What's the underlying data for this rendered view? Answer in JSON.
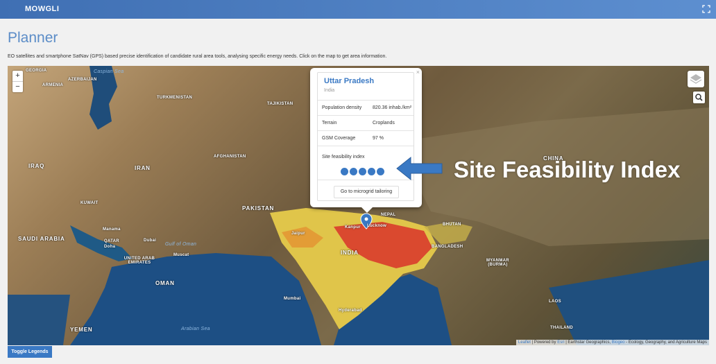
{
  "app": {
    "brand": "MOWGLI"
  },
  "page": {
    "title": "Planner",
    "subtitle": "EO satellites and smartphone SatNav (GPS) based precise identification of candidate rural area tools, analysing specific energy needs. Click on the map to get area information."
  },
  "map": {
    "zoom_in": "+",
    "zoom_out": "−",
    "labels": {
      "caspian": "Caspian Sea",
      "georgia": "GEORGIA",
      "armenia": "ARMENIA",
      "azerbaijan": "AZERBAIJAN",
      "turkmenistan": "TURKMENISTAN",
      "tajikistan": "TAJIKISTAN",
      "iraq": "IRAQ",
      "iran": "IRAN",
      "afghanistan": "AFGHANISTAN",
      "kuwait": "KUWAIT",
      "pakistan": "PAKISTAN",
      "saudi": "SAUDI ARABIA",
      "manama": "Manama",
      "qatar": "QATAR",
      "doha": "Doha",
      "dubai": "Dubai",
      "uae": "UNITED ARAB EMIRATES",
      "gulf_oman": "Gulf of Oman",
      "muscat": "Muscat",
      "oman": "OMAN",
      "yemen": "YEMEN",
      "arabian_sea": "Arabian Sea",
      "india": "INDIA",
      "nepal": "NEPAL",
      "bhutan": "BHUTAN",
      "bangladesh": "BANGLADESH",
      "myanmar": "MYANMAR\n(BURMA)",
      "china": "CHINA",
      "laos": "LAOS",
      "thailand": "THAILAND",
      "kanpur": "Kanpur",
      "lucknow": "Lucknow",
      "jaipur": "Jaipur",
      "hyderabad": "Hyderabad",
      "mumbai": "Mumbai"
    },
    "popup": {
      "region": "Uttar Pradesh",
      "country": "India",
      "population_label": "Population density",
      "population_value": "820.36 inhab./km²",
      "terrain_label": "Terrain",
      "terrain_value": "Croplands",
      "gsm_label": "GSM Coverage",
      "gsm_value": "97 %",
      "feasibility_label": "Site feasibility index",
      "feasibility_score": 5,
      "feasibility_max": 5,
      "button_label": "Go to microgrid tailoring",
      "close": "×"
    },
    "annotation": "Site Feasibility Index",
    "attribution": {
      "leaflet": "Leaflet",
      "powered": "| Powered by",
      "esri": "Esri",
      "earthstar": "| Earthstar Geographics,",
      "biogeo": "Biogeo",
      "rest": "- Ecology, Geography, and Agriculture Maps"
    }
  },
  "footer": {
    "toggle_legends": "Toggle Legends"
  },
  "colors": {
    "accent": "#3a79c4",
    "heat_high": "#d8322a",
    "heat_low": "#e8d24a"
  }
}
